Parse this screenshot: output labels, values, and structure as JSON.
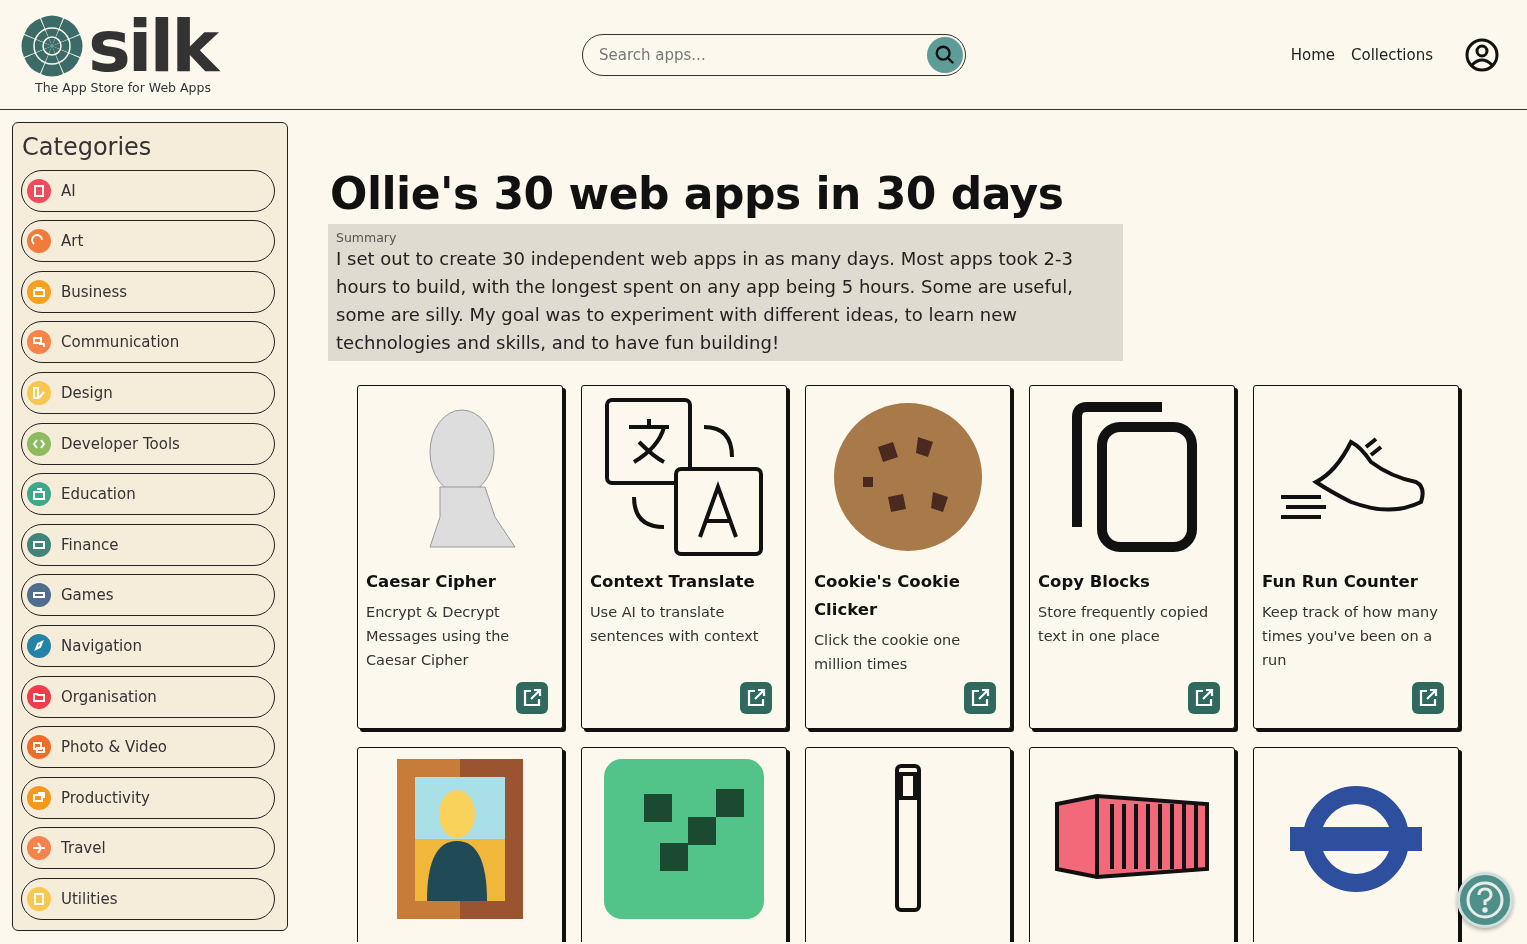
{
  "header": {
    "logo_text": "silk",
    "tagline": "The App Store for Web Apps",
    "search": {
      "placeholder": "Search apps..."
    },
    "nav": [
      "Home",
      "Collections"
    ]
  },
  "sidebar": {
    "title": "Categories",
    "items": [
      {
        "label": "AI",
        "color": "#ef4b5a"
      },
      {
        "label": "Art",
        "color": "#f07b3a"
      },
      {
        "label": "Business",
        "color": "#f5a020"
      },
      {
        "label": "Communication",
        "color": "#f5834a"
      },
      {
        "label": "Design",
        "color": "#f8c74d"
      },
      {
        "label": "Developer Tools",
        "color": "#8dbb5f"
      },
      {
        "label": "Education",
        "color": "#3ea88a"
      },
      {
        "label": "Finance",
        "color": "#3f857a"
      },
      {
        "label": "Games",
        "color": "#4f6e8f"
      },
      {
        "label": "Navigation",
        "color": "#2483a6"
      },
      {
        "label": "Organisation",
        "color": "#ef3e4a"
      },
      {
        "label": "Photo & Video",
        "color": "#f06c2a"
      },
      {
        "label": "Productivity",
        "color": "#f6981d"
      },
      {
        "label": "Travel",
        "color": "#f5834a"
      },
      {
        "label": "Utilities",
        "color": "#f8c74d"
      }
    ]
  },
  "page": {
    "title": "Ollie's 30 web apps in 30 days",
    "summary_label": "Summary",
    "summary": "I set out to create 30 independent web apps in as many days. Most apps took 2-3 hours to build, with the longest spent on any app being 5 hours. Some are useful, some are silly. My goal was to experiment with different ideas, to learn new technologies and skills, and to have fun building!"
  },
  "apps": [
    {
      "kind": "bust",
      "title": "Caesar Cipher",
      "description": "Encrypt & Decrypt Messages using the Caesar Cipher"
    },
    {
      "kind": "translate",
      "title": "Context Translate",
      "description": "Use AI to translate sentences with context"
    },
    {
      "kind": "cookie",
      "title": "Cookie's Cookie Clicker",
      "description": "Click the cookie one million times"
    },
    {
      "kind": "copy",
      "title": "Copy Blocks",
      "description": "Store frequently copied text in one place"
    },
    {
      "kind": "shoe",
      "title": "Fun Run Counter",
      "description": "Keep track of how many times you've been on a run"
    },
    {
      "kind": "painting"
    },
    {
      "kind": "pattern"
    },
    {
      "kind": "scrollbar"
    },
    {
      "kind": "container"
    },
    {
      "kind": "roundel"
    }
  ]
}
